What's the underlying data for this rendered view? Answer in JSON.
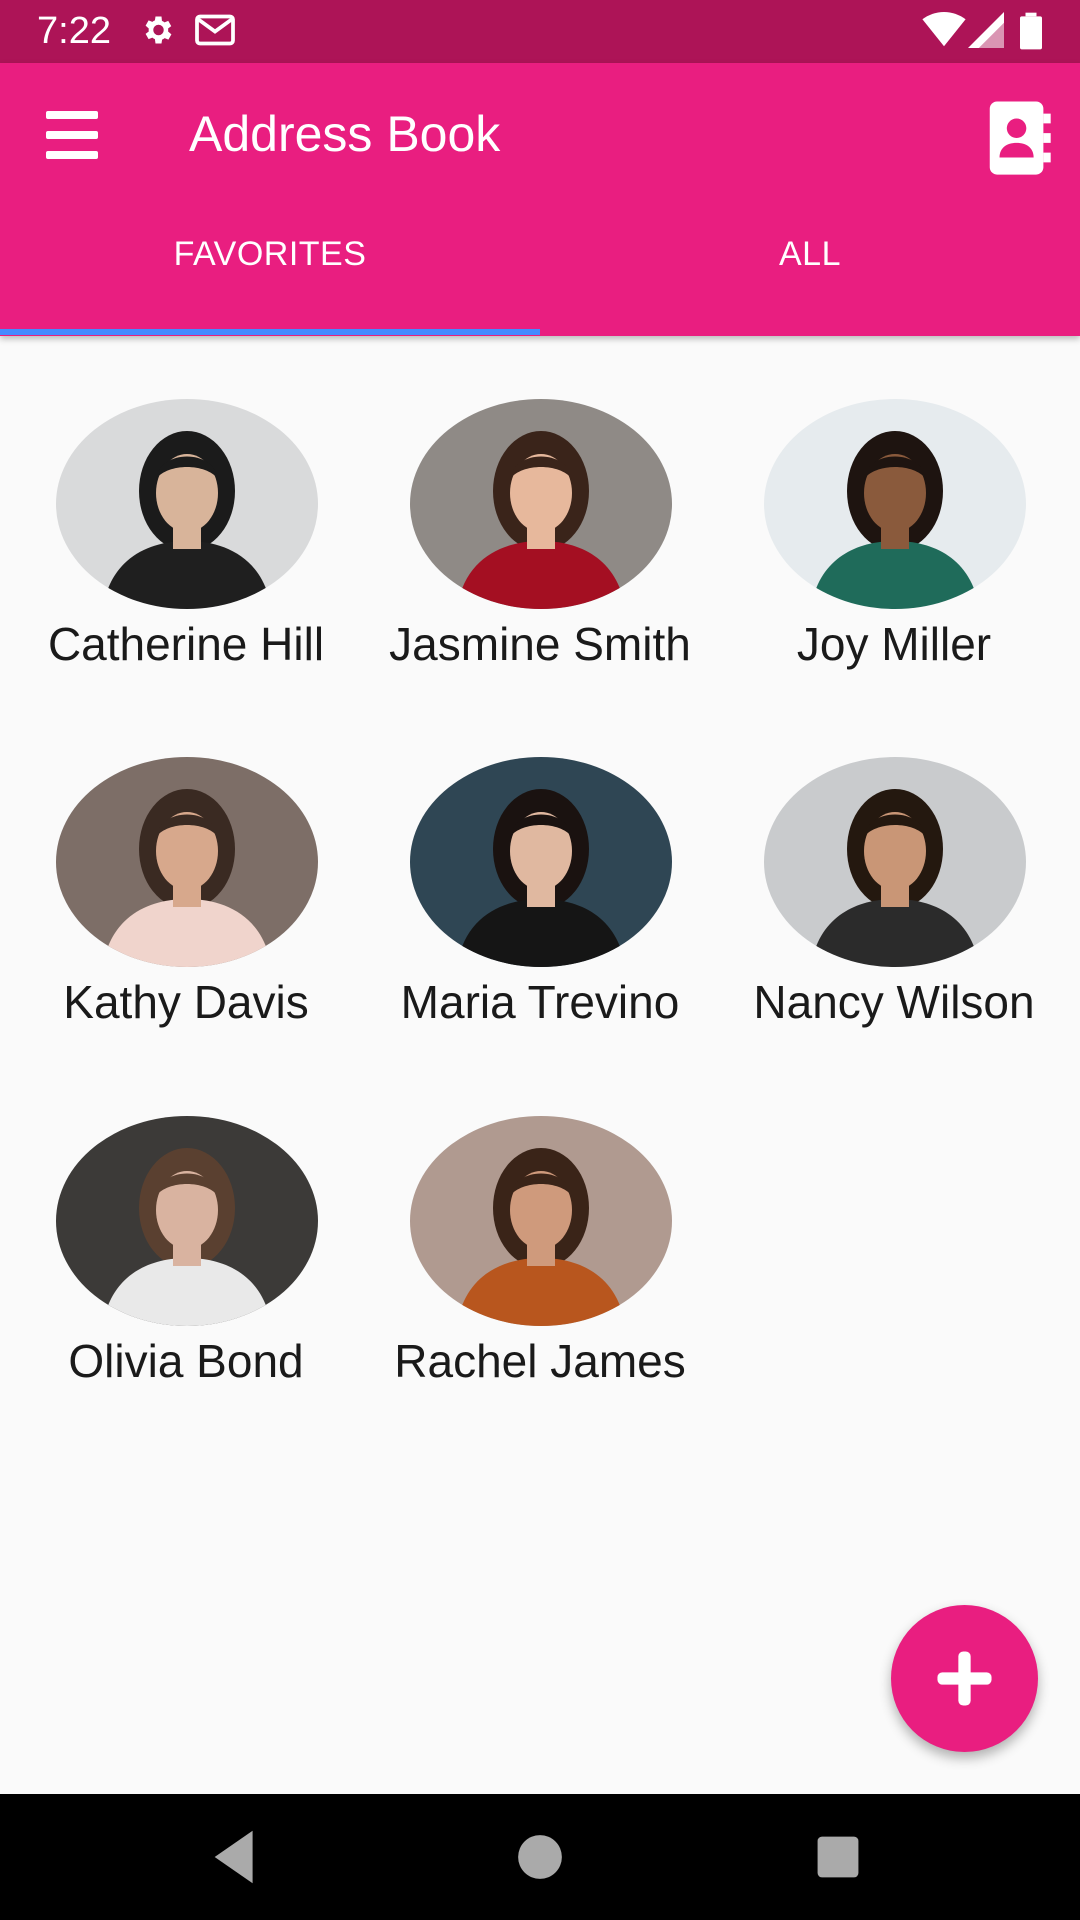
{
  "status_bar": {
    "time": "7:22",
    "icons": [
      "settings-icon",
      "gmail-icon",
      "wifi-icon",
      "signal-icon",
      "battery-icon"
    ]
  },
  "app_bar": {
    "title": "Address Book",
    "menu_icon": "menu-icon",
    "action_icon": "contacts-icon"
  },
  "tabs": [
    {
      "label": "FAVORITES",
      "selected": true
    },
    {
      "label": "ALL",
      "selected": false
    }
  ],
  "contacts": [
    {
      "name": "Catherine Hill",
      "bg": "#d9dadb",
      "hair": "#1b1b1b",
      "skin": "#d8b49a",
      "shirt": "#1f1f1f"
    },
    {
      "name": "Jasmine Smith",
      "bg": "#8f8a86",
      "hair": "#3a241a",
      "skin": "#e7b89c",
      "shirt": "#a40f22"
    },
    {
      "name": "Joy Miller",
      "bg": "#e6ebee",
      "hair": "#1e1410",
      "skin": "#8a5a3c",
      "shirt": "#1f6b5a"
    },
    {
      "name": "Kathy Davis",
      "bg": "#7d6e67",
      "hair": "#3a2a22",
      "skin": "#d7a88c",
      "shirt": "#f0d4cc"
    },
    {
      "name": "Maria Trevino",
      "bg": "#2f4654",
      "hair": "#1a1210",
      "skin": "#e0b8a0",
      "shirt": "#151515"
    },
    {
      "name": "Nancy Wilson",
      "bg": "#c9cbcd",
      "hair": "#24180f",
      "skin": "#c99676",
      "shirt": "#2b2b2b"
    },
    {
      "name": "Olivia Bond",
      "bg": "#3c3a38",
      "hair": "#5a4030",
      "skin": "#d9b3a0",
      "shirt": "#e9e9e9"
    },
    {
      "name": "Rachel James",
      "bg": "#b09a90",
      "hair": "#3a2418",
      "skin": "#cf9a7c",
      "shirt": "#b8561e"
    }
  ],
  "fab": {
    "icon": "add-icon"
  },
  "nav_bar": {
    "icons": [
      "back-icon",
      "home-icon",
      "recents-icon"
    ]
  },
  "colors": {
    "primary": "#e91e80",
    "status_bar": "#ad1457",
    "tab_indicator": "#448aff"
  }
}
